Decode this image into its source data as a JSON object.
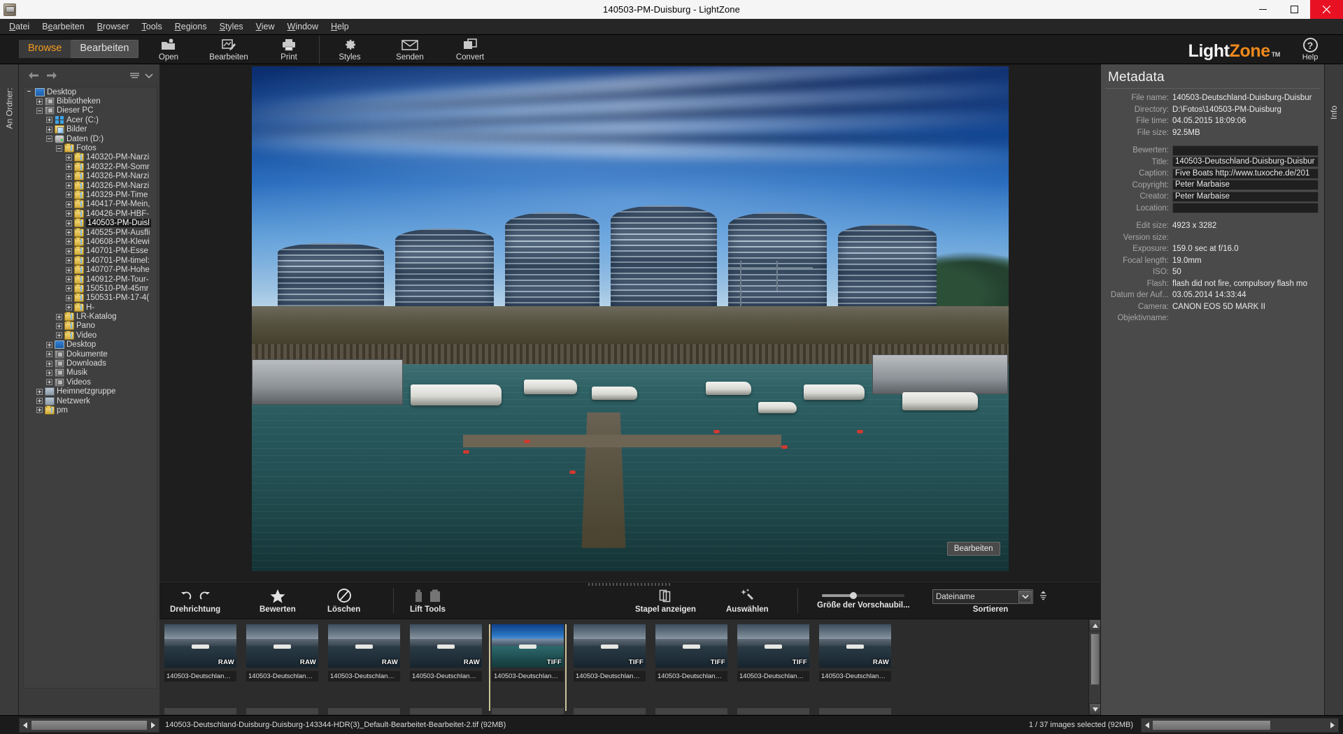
{
  "window": {
    "title": "140503-PM-Duisburg - LightZone",
    "minimize_label": "minimize-icon",
    "maximize_label": "maximize-icon",
    "close_label": "close-icon"
  },
  "menubar": {
    "items": [
      {
        "label": "Datei",
        "mnemonic": "D"
      },
      {
        "label": "Bearbeiten",
        "mnemonic": "e"
      },
      {
        "label": "Browser",
        "mnemonic": "B"
      },
      {
        "label": "Tools",
        "mnemonic": "T"
      },
      {
        "label": "Regions",
        "mnemonic": "R"
      },
      {
        "label": "Styles",
        "mnemonic": "S"
      },
      {
        "label": "View",
        "mnemonic": "V"
      },
      {
        "label": "Window",
        "mnemonic": "W"
      },
      {
        "label": "Help",
        "mnemonic": "H"
      }
    ]
  },
  "toolbar": {
    "mode_browse": "Browse",
    "mode_edit": "Bearbeiten",
    "buttons": [
      {
        "label": "Open",
        "icon": "open-folder-icon"
      },
      {
        "label": "Bearbeiten",
        "icon": "edit-photo-icon"
      },
      {
        "label": "Print",
        "icon": "printer-icon"
      },
      {
        "label": "Styles",
        "icon": "gear-icon"
      },
      {
        "label": "Senden",
        "icon": "envelope-icon"
      },
      {
        "label": "Convert",
        "icon": "convert-icon"
      }
    ],
    "logo_light": "Light",
    "logo_zone": "Zone",
    "logo_tm": "TM",
    "help_label": "Help",
    "help_glyph": "?"
  },
  "left_rail": {
    "tab_label": "An Ordner:"
  },
  "folder_panel": {
    "back_icon": "back-arrow-icon",
    "forward_icon": "forward-arrow-icon",
    "list_icon": "list-icon",
    "chevron_icon": "chevron-down-icon",
    "tree": [
      {
        "label": "Desktop",
        "depth": 0,
        "exp": "none",
        "icon": "monitor",
        "selected": false
      },
      {
        "label": "Bibliotheken",
        "depth": 1,
        "exp": "plus",
        "icon": "folder-grey",
        "selected": false
      },
      {
        "label": "Dieser PC",
        "depth": 1,
        "exp": "minus",
        "icon": "folder-grey",
        "selected": false
      },
      {
        "label": "Acer (C:)",
        "depth": 2,
        "exp": "plus",
        "icon": "win",
        "selected": false
      },
      {
        "label": "Bilder",
        "depth": 2,
        "exp": "plus",
        "icon": "pics",
        "selected": false
      },
      {
        "label": "Daten (D:)",
        "depth": 2,
        "exp": "minus",
        "icon": "drive",
        "selected": false
      },
      {
        "label": "Fotos",
        "depth": 3,
        "exp": "minus",
        "icon": "folder",
        "selected": false
      },
      {
        "label": "140320-PM-Narzi",
        "depth": 4,
        "exp": "plus",
        "icon": "folder",
        "selected": false
      },
      {
        "label": "140322-PM-Somr",
        "depth": 4,
        "exp": "plus",
        "icon": "folder",
        "selected": false
      },
      {
        "label": "140326-PM-Narzi",
        "depth": 4,
        "exp": "plus",
        "icon": "folder",
        "selected": false
      },
      {
        "label": "140326-PM-Narzi",
        "depth": 4,
        "exp": "plus",
        "icon": "folder",
        "selected": false
      },
      {
        "label": "140329-PM-Time",
        "depth": 4,
        "exp": "plus",
        "icon": "folder",
        "selected": false
      },
      {
        "label": "140417-PM-Mein,",
        "depth": 4,
        "exp": "plus",
        "icon": "folder",
        "selected": false
      },
      {
        "label": "140426-PM-HBF-",
        "depth": 4,
        "exp": "plus",
        "icon": "folder",
        "selected": false
      },
      {
        "label": "140503-PM-Duisl",
        "depth": 4,
        "exp": "plus",
        "icon": "folder",
        "selected": true
      },
      {
        "label": "140525-PM-Ausfli",
        "depth": 4,
        "exp": "plus",
        "icon": "folder",
        "selected": false
      },
      {
        "label": "140608-PM-Klewi",
        "depth": 4,
        "exp": "plus",
        "icon": "folder",
        "selected": false
      },
      {
        "label": "140701-PM-Esse",
        "depth": 4,
        "exp": "plus",
        "icon": "folder",
        "selected": false
      },
      {
        "label": "140701-PM-timel:",
        "depth": 4,
        "exp": "plus",
        "icon": "folder",
        "selected": false
      },
      {
        "label": "140707-PM-Hohe",
        "depth": 4,
        "exp": "plus",
        "icon": "folder",
        "selected": false
      },
      {
        "label": "140912-PM-Tour-",
        "depth": 4,
        "exp": "plus",
        "icon": "folder",
        "selected": false
      },
      {
        "label": "150510-PM-45mr",
        "depth": 4,
        "exp": "plus",
        "icon": "folder",
        "selected": false
      },
      {
        "label": "150531-PM-17-4(",
        "depth": 4,
        "exp": "plus",
        "icon": "folder",
        "selected": false
      },
      {
        "label": "H-",
        "depth": 4,
        "exp": "plus",
        "icon": "folder",
        "selected": false
      },
      {
        "label": "LR-Katalog",
        "depth": 3,
        "exp": "plus",
        "icon": "folder",
        "selected": false
      },
      {
        "label": "Pano",
        "depth": 3,
        "exp": "plus",
        "icon": "folder",
        "selected": false
      },
      {
        "label": "Video",
        "depth": 3,
        "exp": "plus",
        "icon": "folder",
        "selected": false
      },
      {
        "label": "Desktop",
        "depth": 2,
        "exp": "plus",
        "icon": "monitor",
        "selected": false
      },
      {
        "label": "Dokumente",
        "depth": 2,
        "exp": "plus",
        "icon": "folder-grey",
        "selected": false
      },
      {
        "label": "Downloads",
        "depth": 2,
        "exp": "plus",
        "icon": "folder-grey",
        "selected": false
      },
      {
        "label": "Musik",
        "depth": 2,
        "exp": "plus",
        "icon": "folder-grey",
        "selected": false
      },
      {
        "label": "Videos",
        "depth": 2,
        "exp": "plus",
        "icon": "folder-grey",
        "selected": false
      },
      {
        "label": "Heimnetzgruppe",
        "depth": 1,
        "exp": "plus",
        "icon": "net",
        "selected": false
      },
      {
        "label": "Netzwerk",
        "depth": 1,
        "exp": "plus",
        "icon": "net",
        "selected": false
      },
      {
        "label": "pm",
        "depth": 1,
        "exp": "plus",
        "icon": "folder",
        "selected": false
      }
    ]
  },
  "viewer": {
    "edit_badge": "Bearbeiten"
  },
  "strip_toolbar": {
    "rotate": {
      "label": "Drehrichtung",
      "icon_left": "rotate-ccw-icon",
      "icon_right": "rotate-cw-icon"
    },
    "rate": {
      "label": "Bewerten",
      "icon": "star-icon"
    },
    "delete": {
      "label": "Löschen",
      "icon": "no-entry-icon"
    },
    "lift_tools": {
      "label": "Lift Tools",
      "icon_left": "lift-icon",
      "icon_right": "stamp-icon"
    },
    "stack": {
      "label": "Stapel anzeigen",
      "icon": "stack-icon"
    },
    "select": {
      "label": "Auswählen",
      "icon": "magic-wand-icon"
    },
    "thumb_size": {
      "label": "Größe der Vorschaubil...",
      "value": 33
    },
    "sort": {
      "label": "Sortieren",
      "value": "Dateiname",
      "options": [
        "Dateiname"
      ],
      "direction_icon": "sort-direction-icon",
      "chevron": "chevron-down-icon"
    }
  },
  "filmstrip": {
    "scroll_up_icon": "scroll-up-icon",
    "scroll_down_icon": "scroll-down-icon",
    "thumbs": [
      {
        "label": "140503-Deutschland-D...",
        "format": "RAW",
        "selected": false
      },
      {
        "label": "140503-Deutschland-D...",
        "format": "RAW",
        "selected": false
      },
      {
        "label": "140503-Deutschland-D...",
        "format": "RAW",
        "selected": false
      },
      {
        "label": "140503-Deutschland-D...",
        "format": "RAW",
        "selected": false
      },
      {
        "label": "140503-Deutschland-D...",
        "format": "TIFF",
        "selected": true
      },
      {
        "label": "140503-Deutschland-D...",
        "format": "TIFF",
        "selected": false
      },
      {
        "label": "140503-Deutschland-D...",
        "format": "TIFF",
        "selected": false
      },
      {
        "label": "140503-Deutschland-D...",
        "format": "TIFF",
        "selected": false
      },
      {
        "label": "140503-Deutschland-D...",
        "format": "RAW",
        "selected": false
      }
    ]
  },
  "metadata": {
    "panel_title": "Metadata",
    "rail_tab": "Info",
    "rows": [
      {
        "key": "File name:",
        "value": "140503-Deutschland-Duisburg-Duisbur",
        "field": false
      },
      {
        "key": "Directory:",
        "value": "D:\\Fotos\\140503-PM-Duisburg",
        "field": false
      },
      {
        "key": "File time:",
        "value": "04.05.2015 18:09:06",
        "field": false
      },
      {
        "key": "File size:",
        "value": "92.5MB",
        "field": false
      },
      {
        "key": "__gap__",
        "value": "",
        "field": false
      },
      {
        "key": "Bewerten:",
        "value": "",
        "field": true
      },
      {
        "key": "Title:",
        "value": "140503-Deutschland-Duisburg-Duisbur",
        "field": true
      },
      {
        "key": "Caption:",
        "value": "Five Boats http://www.tuxoche.de/201",
        "field": true
      },
      {
        "key": "Copyright:",
        "value": "Peter Marbaise",
        "field": true
      },
      {
        "key": "Creator:",
        "value": "Peter Marbaise",
        "field": true
      },
      {
        "key": "Location:",
        "value": "",
        "field": true
      },
      {
        "key": "__gap__",
        "value": "",
        "field": false
      },
      {
        "key": "Edit size:",
        "value": "4923 x 3282",
        "field": false
      },
      {
        "key": "Version size:",
        "value": "",
        "field": false
      },
      {
        "key": "Exposure:",
        "value": "159.0 sec at f/16.0",
        "field": false
      },
      {
        "key": "Focal length:",
        "value": "19.0mm",
        "field": false
      },
      {
        "key": "ISO:",
        "value": "50",
        "field": false
      },
      {
        "key": "Flash:",
        "value": "flash did not fire, compulsory flash mo",
        "field": false
      },
      {
        "key": "Datum der Auf...",
        "value": "03.05.2014 14:33:44",
        "field": false
      },
      {
        "key": "Camera:",
        "value": "CANON EOS 5D MARK II",
        "field": false
      },
      {
        "key": "Objektivname:",
        "value": "",
        "field": false
      }
    ]
  },
  "statusbar": {
    "file_info": "140503-Deutschland-Duisburg-Duisburg-143344-HDR(3)_Default-Bearbeitet-Bearbeitet-2.tif (92MB)",
    "selection_info": "1 / 37 images selected (92MB)",
    "left_arrow": "scroll-left-icon",
    "right_arrow": "scroll-right-icon"
  },
  "colors": {
    "accent_orange": "#f08a1c",
    "panel_grey": "#4a4a4a",
    "tree_bg": "#3f3f3f",
    "selection_outline": "#cdc49a",
    "close_red": "#e81123"
  }
}
